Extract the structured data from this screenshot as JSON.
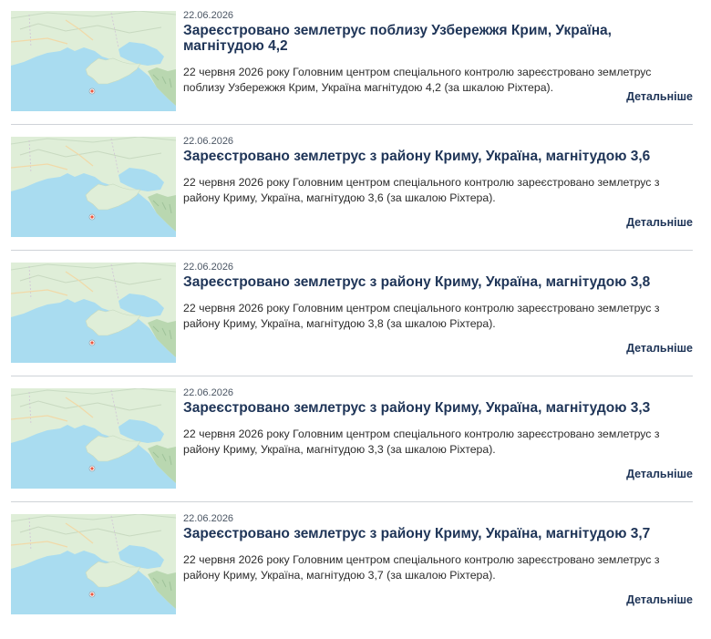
{
  "news": [
    {
      "date": "22.06.2026",
      "title": "Зареєстровано землетрус поблизу Узбережжя Крим, Україна, магнітудою 4,2",
      "text": "22 червня 2026 року Головним центром спеціального контролю зареєстровано землетрус поблизу Узбережжя Крим, Україна магнітудою 4,2 (за шкалою Ріхтера).",
      "more": "Детальніше",
      "map_icon": "crimea-map-thumbnail"
    },
    {
      "date": "22.06.2026",
      "title": "Зареєстровано землетрус з району Криму, Україна, магнітудою 3,6",
      "text": "22 червня 2026 року Головним центром спеціального контролю зареєстровано землетрус з району Криму, Україна, магнітудою 3,6 (за шкалою Ріхтера).",
      "more": "Детальніше",
      "map_icon": "crimea-map-thumbnail"
    },
    {
      "date": "22.06.2026",
      "title": "Зареєстровано землетрус з району Криму, Україна, магнітудою 3,8",
      "text": "22 червня 2026 року Головним центром спеціального контролю зареєстровано землетрус з району Криму, Україна, магнітудою 3,8 (за шкалою Ріхтера).",
      "more": "Детальніше",
      "map_icon": "crimea-map-thumbnail"
    },
    {
      "date": "22.06.2026",
      "title": "Зареєстровано землетрус з району Криму, Україна, магнітудою 3,3",
      "text": "22 червня 2026 року Головним центром спеціального контролю зареєстровано землетрус з району Криму, Україна, магнітудою 3,3 (за шкалою Ріхтера).",
      "more": "Детальніше",
      "map_icon": "crimea-map-thumbnail"
    },
    {
      "date": "22.06.2026",
      "title": "Зареєстровано землетрус з району Криму, Україна, магнітудою 3,7",
      "text": "22 червня 2026 року Головним центром спеціального контролю зареєстровано землетрус з району Криму, Україна, магнітудою 3,7 (за шкалою Ріхтера).",
      "more": "Детальніше",
      "map_icon": "crimea-map-thumbnail"
    }
  ],
  "colors": {
    "sea": "#a9dcf0",
    "land": "#dfeed8",
    "mountain": "#b9d7b0",
    "title": "#1e3457",
    "marker": "#e9573f"
  }
}
